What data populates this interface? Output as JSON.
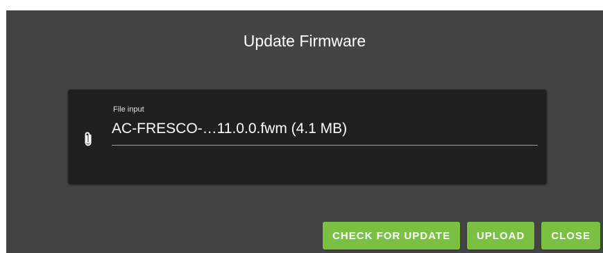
{
  "dialog": {
    "title": "Update Firmware"
  },
  "file_input": {
    "label": "File input",
    "value": "AC-FRESCO-…11.0.0.fwm (4.1 MB)",
    "icon": "paperclip-icon"
  },
  "actions": {
    "check_label": "CHECK FOR UPDATE",
    "upload_label": "UPLOAD",
    "close_label": "CLOSE"
  },
  "colors": {
    "dialog_bg": "#444444",
    "card_bg": "#202020",
    "accent": "#7ac143"
  }
}
